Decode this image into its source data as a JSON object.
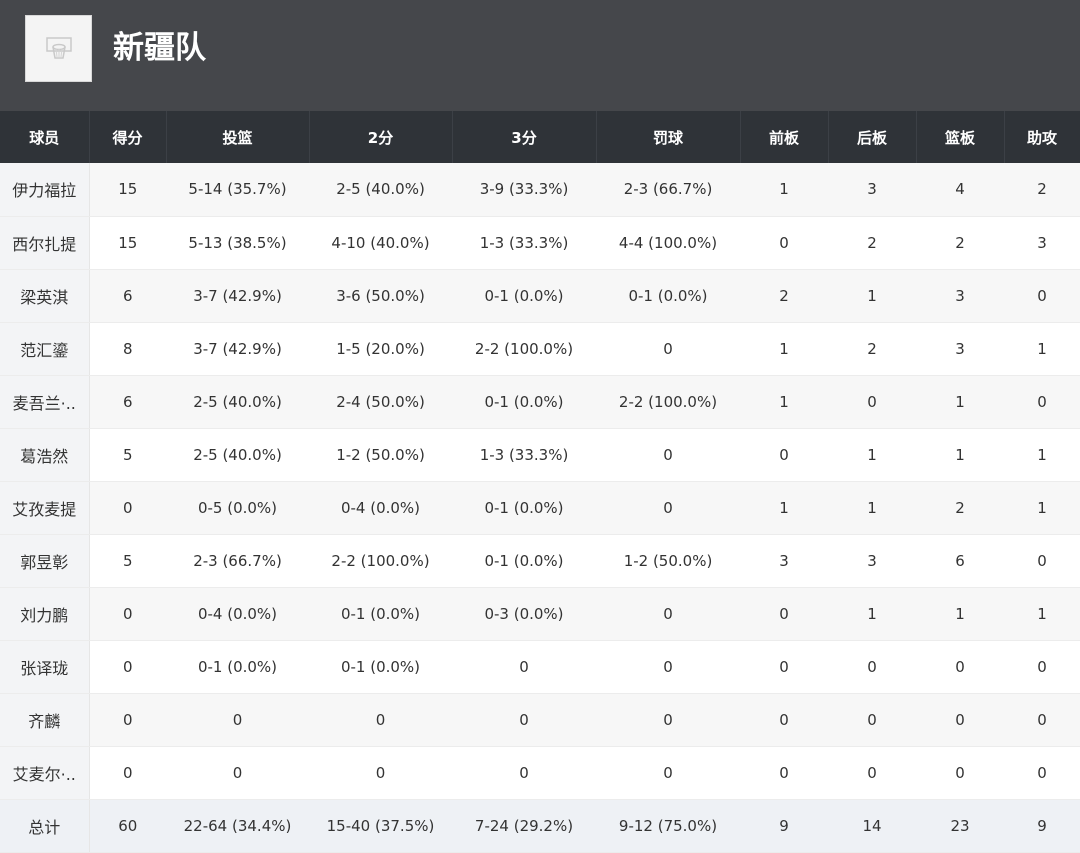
{
  "team": {
    "name": "新疆队",
    "logo_icon": "team-logo-icon"
  },
  "columns": [
    "球员",
    "得分",
    "投篮",
    "2分",
    "3分",
    "罚球",
    "前板",
    "后板",
    "篮板",
    "助攻"
  ],
  "rows": [
    [
      "伊力福拉",
      "15",
      "5-14 (35.7%)",
      "2-5 (40.0%)",
      "3-9 (33.3%)",
      "2-3 (66.7%)",
      "1",
      "3",
      "4",
      "2"
    ],
    [
      "西尔扎提",
      "15",
      "5-13 (38.5%)",
      "4-10 (40.0%)",
      "1-3 (33.3%)",
      "4-4 (100.0%)",
      "0",
      "2",
      "2",
      "3"
    ],
    [
      "梁英淇",
      "6",
      "3-7 (42.9%)",
      "3-6 (50.0%)",
      "0-1 (0.0%)",
      "0-1 (0.0%)",
      "2",
      "1",
      "3",
      "0"
    ],
    [
      "范汇鎏",
      "8",
      "3-7 (42.9%)",
      "1-5 (20.0%)",
      "2-2 (100.0%)",
      "0",
      "1",
      "2",
      "3",
      "1"
    ],
    [
      "麦吾兰·..",
      "6",
      "2-5 (40.0%)",
      "2-4 (50.0%)",
      "0-1 (0.0%)",
      "2-2 (100.0%)",
      "1",
      "0",
      "1",
      "0"
    ],
    [
      "葛浩然",
      "5",
      "2-5 (40.0%)",
      "1-2 (50.0%)",
      "1-3 (33.3%)",
      "0",
      "0",
      "1",
      "1",
      "1"
    ],
    [
      "艾孜麦提",
      "0",
      "0-5 (0.0%)",
      "0-4 (0.0%)",
      "0-1 (0.0%)",
      "0",
      "1",
      "1",
      "2",
      "1"
    ],
    [
      "郭昱彰",
      "5",
      "2-3 (66.7%)",
      "2-2 (100.0%)",
      "0-1 (0.0%)",
      "1-2 (50.0%)",
      "3",
      "3",
      "6",
      "0"
    ],
    [
      "刘力鹏",
      "0",
      "0-4 (0.0%)",
      "0-1 (0.0%)",
      "0-3 (0.0%)",
      "0",
      "0",
      "1",
      "1",
      "1"
    ],
    [
      "张译珑",
      "0",
      "0-1 (0.0%)",
      "0-1 (0.0%)",
      "0",
      "0",
      "0",
      "0",
      "0",
      "0"
    ],
    [
      "齐麟",
      "0",
      "0",
      "0",
      "0",
      "0",
      "0",
      "0",
      "0",
      "0"
    ],
    [
      "艾麦尔·..",
      "0",
      "0",
      "0",
      "0",
      "0",
      "0",
      "0",
      "0",
      "0"
    ]
  ],
  "total": [
    "总计",
    "60",
    "22-64 (34.4%)",
    "15-40 (37.5%)",
    "7-24 (29.2%)",
    "9-12 (75.0%)",
    "9",
    "14",
    "23",
    "9"
  ],
  "colors": {
    "header_bg": "#45474b",
    "table_header_bg": "#2f3338"
  }
}
